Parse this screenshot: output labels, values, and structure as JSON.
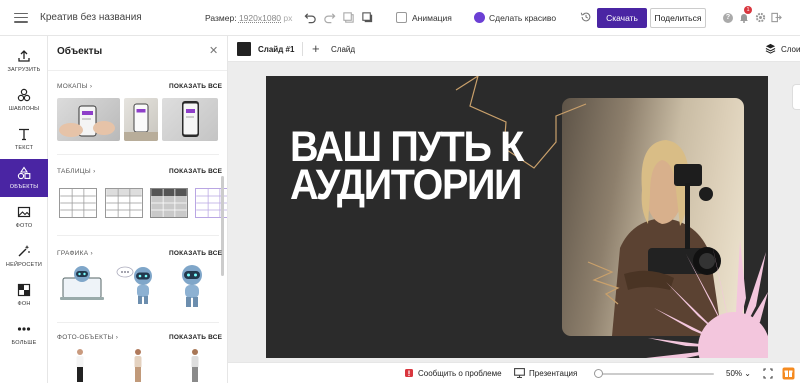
{
  "header": {
    "title": "Креатив без названия",
    "size_label": "Размер:",
    "size_value": "1920x1080",
    "size_unit": "px",
    "animation_label": "Анимация",
    "magic_label": "Сделать красиво",
    "download_label": "Скачать",
    "share_label": "Поделиться",
    "notifications_count": "1",
    "help_symbol": "?"
  },
  "sidebar": {
    "items": [
      {
        "label": "ЗАГРУЗИТЬ",
        "icon": "upload-icon"
      },
      {
        "label": "ШАБЛОНЫ",
        "icon": "templates-icon"
      },
      {
        "label": "ТЕКСТ",
        "icon": "text-icon"
      },
      {
        "label": "ОБЪЕКТЫ",
        "icon": "shapes-icon",
        "active": true
      },
      {
        "label": "ФОТО",
        "icon": "photo-icon"
      },
      {
        "label": "НЕЙРОСЕТИ",
        "icon": "ai-wand-icon"
      },
      {
        "label": "ФОН",
        "icon": "background-icon"
      },
      {
        "label": "БОЛЬШЕ",
        "icon": "more-icon"
      }
    ]
  },
  "panel": {
    "title": "Объекты",
    "close_symbol": "✕",
    "sections": [
      {
        "title": "МОКАПЫ",
        "chevron": "›",
        "show_all": "ПОКАЗАТЬ ВСЕ"
      },
      {
        "title": "ТАБЛИЦЫ",
        "chevron": "›",
        "show_all": "ПОКАЗАТЬ ВСЕ"
      },
      {
        "title": "ГРАФИКА",
        "chevron": "›",
        "show_all": "ПОКАЗАТЬ ВСЕ"
      },
      {
        "title": "ФОТО-ОБЪЕКТЫ",
        "chevron": "›",
        "show_all": "ПОКАЗАТЬ ВСЕ"
      }
    ]
  },
  "slidebar": {
    "slide_name": "Слайд #1",
    "add_symbol": "+",
    "add_label": "Слайд",
    "layers_label": "Слои"
  },
  "canvas": {
    "headline_line1": "ВАШ ПУТЬ К",
    "headline_line2": "АУДИТОРИИ",
    "background_color": "#2b2b2b",
    "accent_color": "#f3c6dd",
    "zigzag_color": "#c9a06b"
  },
  "footer": {
    "report_label": "Сообщить о проблеме",
    "present_label": "Презентация",
    "zoom_value": "50%",
    "zoom_fraction": 0.02
  },
  "colors": {
    "brand": "#4a25a3",
    "badge": "#d9363e"
  }
}
